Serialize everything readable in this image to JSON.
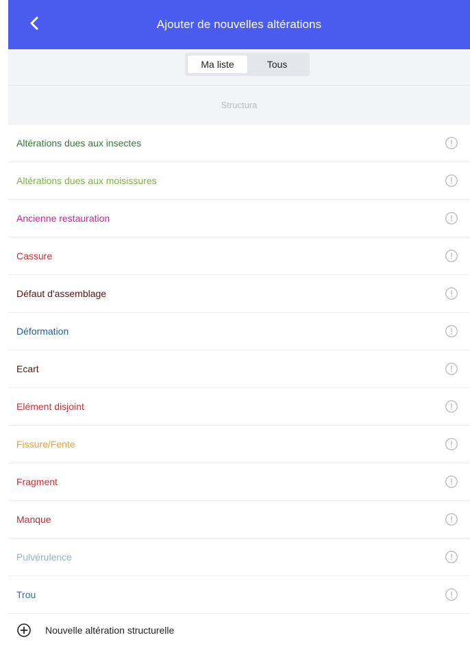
{
  "header": {
    "title": "Ajouter de nouvelles altérations",
    "back_icon": "chevron-left-icon",
    "color": "#4a5cf0"
  },
  "tabs": [
    {
      "label": "Ma liste",
      "active": true
    },
    {
      "label": "Tous",
      "active": false
    }
  ],
  "section": {
    "title": "Structura"
  },
  "items": [
    {
      "label": "Altérations dues aux insectes",
      "color": "#2e7d32",
      "icon": "info-icon"
    },
    {
      "label": "Altérations dues aux moisissures",
      "color": "#7cb342",
      "icon": "info-icon"
    },
    {
      "label": "Ancienne restauration",
      "color": "#d81b9c",
      "icon": "info-icon"
    },
    {
      "label": "Cassure",
      "color": "#d32f2f",
      "icon": "info-icon"
    },
    {
      "label": "Défaut d'assemblage",
      "color": "#5d1010",
      "icon": "info-icon"
    },
    {
      "label": "Déformation",
      "color": "#1f5f91",
      "icon": "info-icon"
    },
    {
      "label": "Ecart",
      "color": "#5a1414",
      "icon": "info-icon"
    },
    {
      "label": "Elément disjoint",
      "color": "#d32f2f",
      "icon": "info-icon"
    },
    {
      "label": "Fissure/Fente",
      "color": "#f0a020",
      "icon": "info-icon"
    },
    {
      "label": "Fragment",
      "color": "#d32f2f",
      "icon": "info-icon"
    },
    {
      "label": "Manque",
      "color": "#c62828",
      "icon": "info-icon"
    },
    {
      "label": "Pulvérulence",
      "color": "#8fb8c0",
      "icon": "info-icon"
    },
    {
      "label": "Trou",
      "color": "#2f6ea6",
      "icon": "info-icon"
    }
  ],
  "footer": {
    "label": "Nouvelle altération structurelle",
    "icon": "add-circle-icon"
  }
}
